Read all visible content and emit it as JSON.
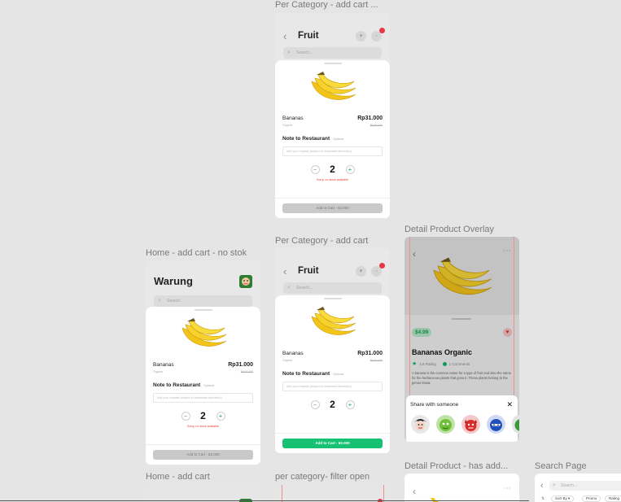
{
  "frames": [
    {
      "label": "Per Category - add cart ..."
    },
    {
      "label": "Home - add cart - no stok"
    },
    {
      "label": "Per Category - add cart"
    },
    {
      "label": "Detail Product Overlay"
    },
    {
      "label": "Home - add cart"
    },
    {
      "label": "per category- filter open"
    },
    {
      "label": "Detail Product - has add..."
    },
    {
      "label": "Search Page"
    }
  ],
  "category_screen": {
    "title": "Fruit",
    "search_placeholder": "Search..."
  },
  "home_screen": {
    "title": "Warung",
    "search_placeholder": "Search..."
  },
  "product_sheet": {
    "name": "Bananas",
    "price": "Rp31.000",
    "subtitle": "Organic",
    "old_price": "Rp34.000",
    "note_title": "Note to Restaurant",
    "note_optional": "Optional",
    "note_placeholder": "Add your request (subject to restaurant discretion)",
    "quantity": "2",
    "out_of_stock": "Sorry, no stock available",
    "cart_button": "Add to Cart - 62.000"
  },
  "detail_overlay": {
    "price": "$4.99",
    "title": "Bananas Organic",
    "rating": "4.8 Rating",
    "comments": "1 Comments",
    "description": "A banana is the common name for a type of fruit and also the name for the herbaceous plants that grow it. These plants belong to the genus Musa.",
    "share_title": "Share with someone"
  },
  "search_page": {
    "placeholder": "Search...",
    "sort_label": "Sort By",
    "chip_promo": "Promo",
    "chip_rating": "Rating"
  },
  "colors": {
    "accent_green": "#16c172",
    "error_red": "#e53935",
    "badge_red": "#e63946"
  }
}
